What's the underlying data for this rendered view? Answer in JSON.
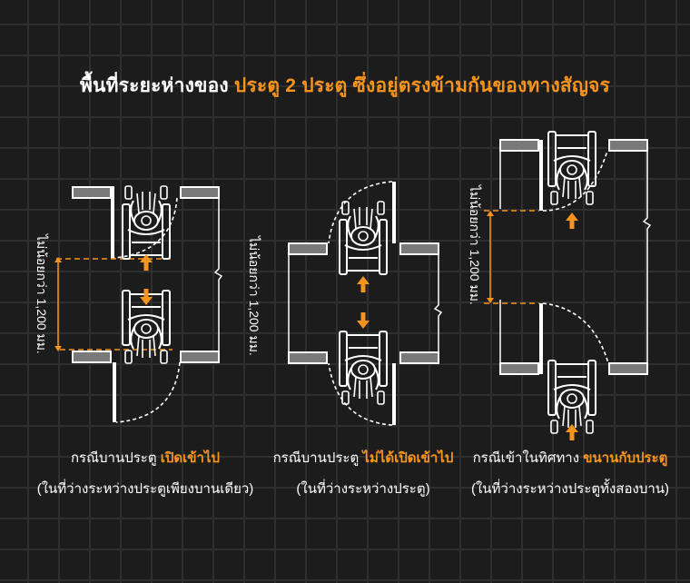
{
  "title": {
    "prefix": "พื้นที่ระยะห่างของ",
    "highlight": "ประตู 2 ประตู ซึ่งอยู่ตรงข้ามกันของทางสัญจร"
  },
  "colors": {
    "background": "#1c1c1c",
    "grid": "#2f2f2f",
    "accent": "#f7941d",
    "line": "#ffffff",
    "wall_fill": "#7a7a7a"
  },
  "dimension_label": "ไม่น้อยกว่า 1,200 มม.",
  "cases": [
    {
      "caption_prefix": "กรณีบานประตู",
      "caption_highlight": "เปิดเข้าไป",
      "note": "(ในที่ว่างระหว่างประตูเพียงบานเดียว)"
    },
    {
      "caption_prefix": "กรณีบานประตู",
      "caption_highlight": "ไม่ได้เปิดเข้าไป",
      "note": "(ในที่ว่างระหว่างประตู)"
    },
    {
      "caption_prefix": "กรณีเข้าในทิศทาง",
      "caption_highlight": "ขนานกับประตู",
      "note": "(ในที่ว่างระหว่างประตูทั้งสองบาน)"
    }
  ],
  "icons": [
    "wheelchair-icon",
    "arrow-up-icon",
    "arrow-down-icon",
    "door-swing-arc"
  ]
}
